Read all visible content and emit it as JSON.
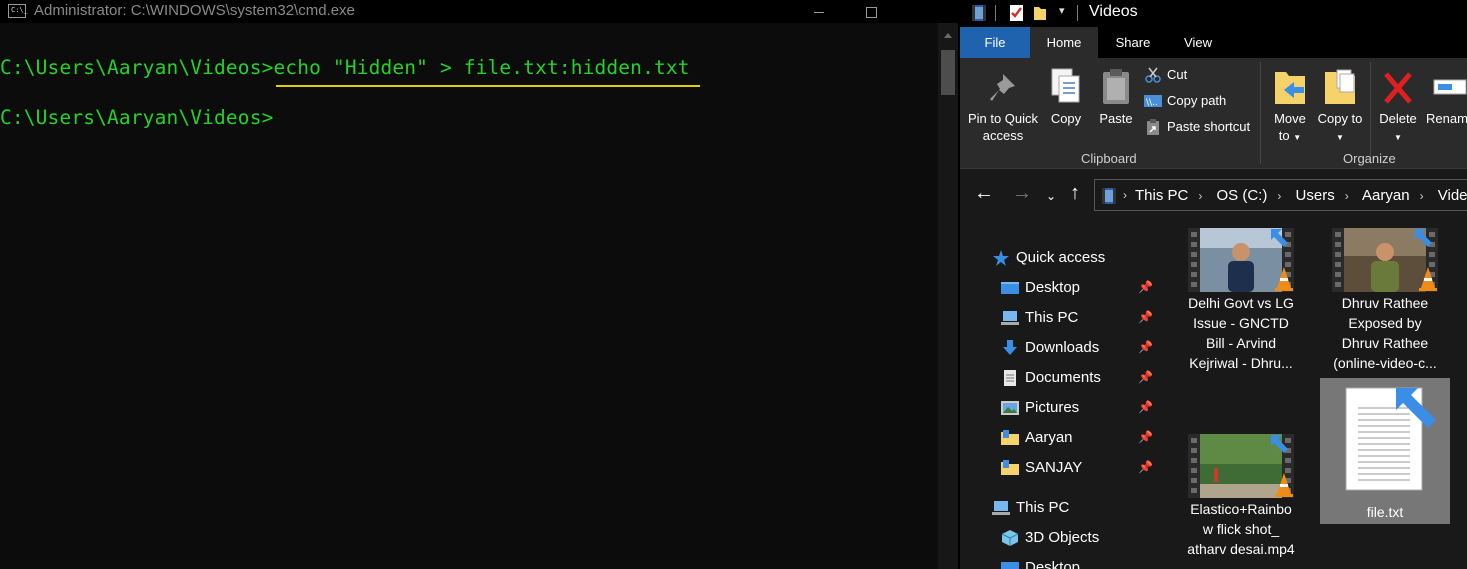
{
  "cmd": {
    "title": "Administrator: C:\\WINDOWS\\system32\\cmd.exe",
    "app_icon_text": "C:\\_",
    "prompt": "C:\\Users\\Aaryan\\Videos>",
    "command": "echo \"Hidden\" > file.txt:hidden.txt",
    "text_color": "#25d12a",
    "highlight_color": "#e6cb07"
  },
  "explorer": {
    "title": "Videos",
    "tabs": [
      "File",
      "Home",
      "Share",
      "View"
    ],
    "ribbon": {
      "pin": "Pin to Quick access",
      "copy": "Copy",
      "paste": "Paste",
      "cut": "Cut",
      "copy_path": "Copy path",
      "paste_shortcut": "Paste shortcut",
      "clipboard_group": "Clipboard",
      "move_to": "Move to",
      "copy_to": "Copy to",
      "delete": "Delete",
      "rename": "Rename",
      "organize_group": "Organize"
    },
    "breadcrumb": [
      "This PC",
      "OS (C:)",
      "Users",
      "Aaryan",
      "Videos"
    ],
    "nav": {
      "quick_access": "Quick access",
      "pinned": [
        "Desktop",
        "This PC",
        "Downloads",
        "Documents",
        "Pictures",
        "Aaryan",
        "SANJAY"
      ],
      "this_pc": "This PC",
      "this_pc_items": [
        "3D Objects",
        "Desktop"
      ]
    },
    "files": [
      {
        "name": "Delhi Govt vs LG Issue - GNCTD Bill - Arvind Kejriwal - Dhru...",
        "line1": "Delhi Govt vs LG",
        "line2": "Issue - GNCTD",
        "line3": "Bill - Arvind",
        "line4": "Kejriwal - Dhru...",
        "type": "video"
      },
      {
        "name": "Dhruv Rathee Exposed by Dhruv Rathee (online-video-c...",
        "line1": "Dhruv Rathee",
        "line2": "Exposed by",
        "line3": "Dhruv Rathee",
        "line4": "(online-video-c...",
        "type": "video"
      },
      {
        "name": "Elastico+Rainbow flick shot_ atharv desai.mp4",
        "line1": "Elastico+Rainbo",
        "line2": "w flick shot_",
        "line3": "atharv desai.mp4",
        "type": "video"
      },
      {
        "name": "file.txt",
        "line1": "file.txt",
        "type": "text",
        "selected": true
      }
    ],
    "accent": "#1f62ad"
  }
}
